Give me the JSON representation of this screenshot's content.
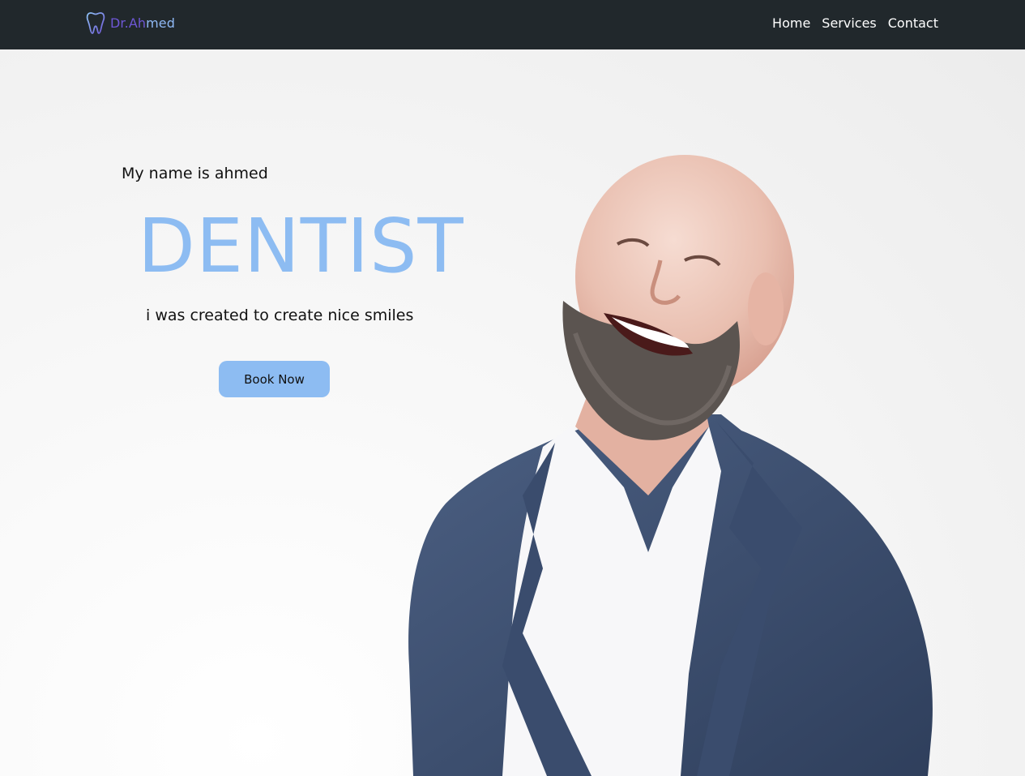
{
  "navbar": {
    "brand": {
      "part1": "Dr.Ah",
      "part2": "med",
      "icon": "tooth-icon"
    },
    "links": [
      {
        "label": "Home"
      },
      {
        "label": "Services"
      },
      {
        "label": "Contact"
      }
    ]
  },
  "hero": {
    "intro": "My name is ahmed",
    "headline": "DENTIST",
    "tagline": "i was created to create nice smiles",
    "cta_label": "Book Now",
    "image": "smiling-bald-man-in-suit-photo"
  },
  "colors": {
    "navbar_bg": "#21282c",
    "accent": "#8dbcf2",
    "brand_purple": "#6e57d6"
  }
}
